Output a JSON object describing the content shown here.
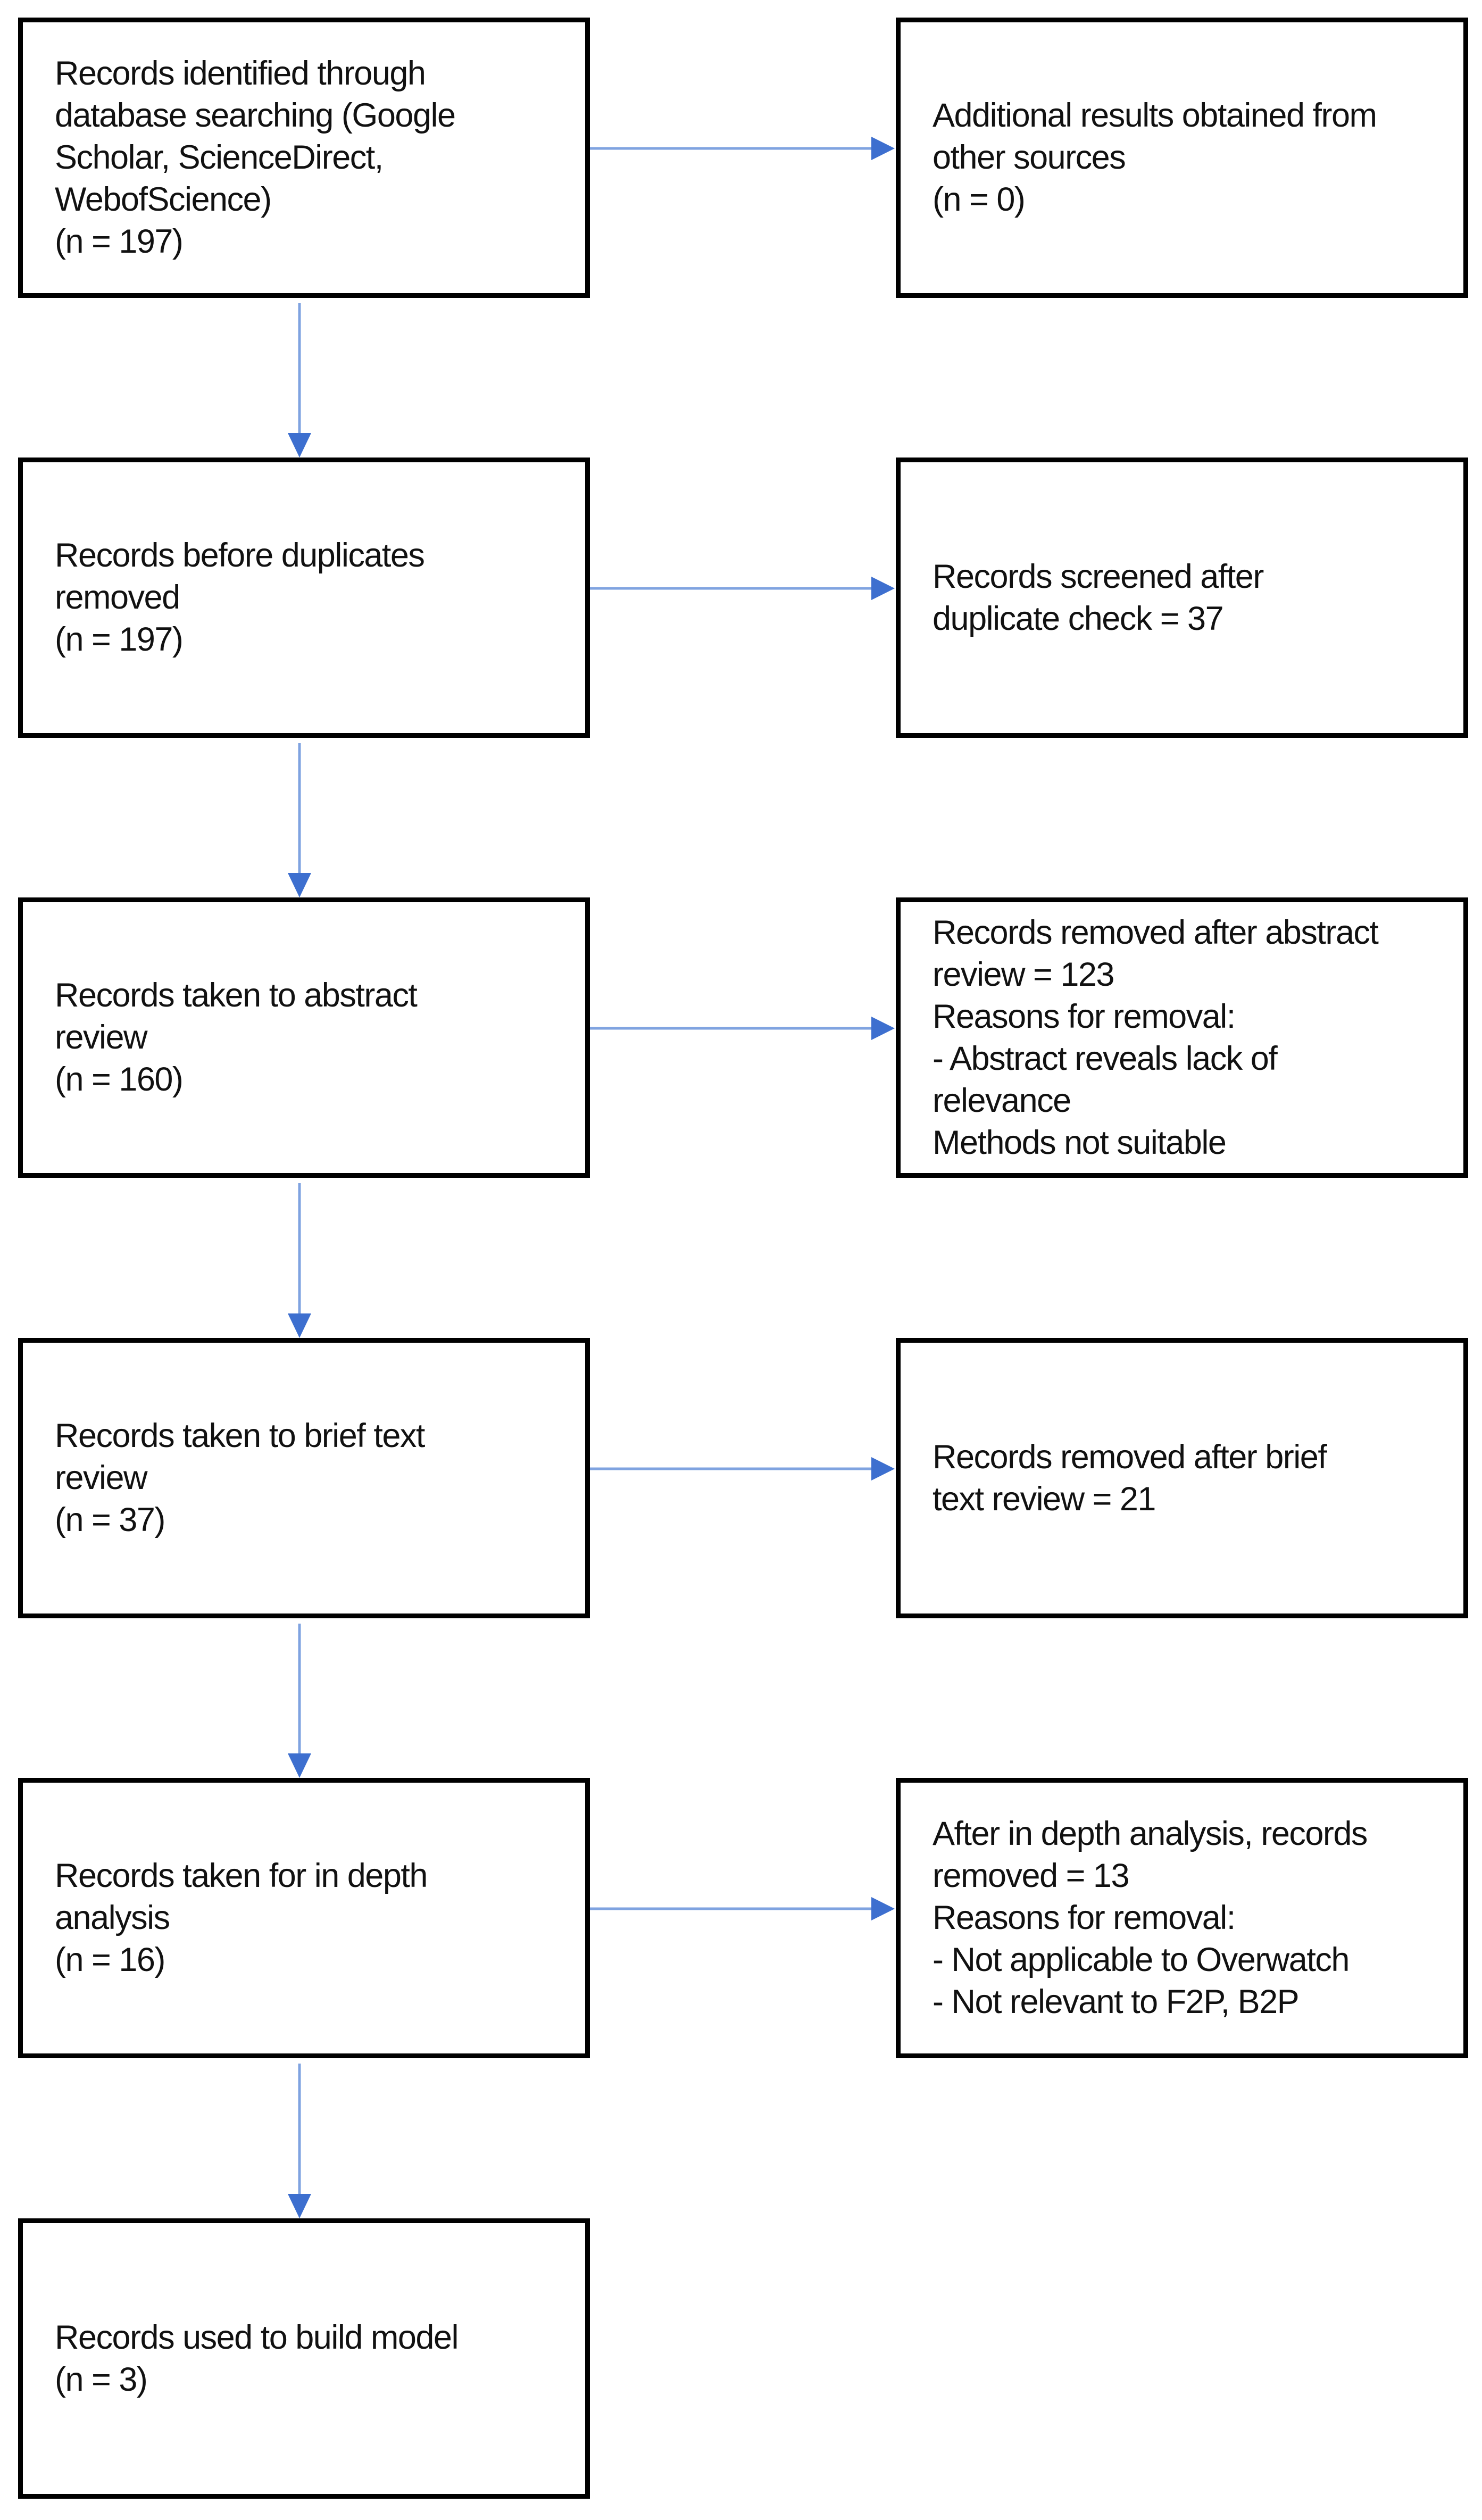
{
  "diagram": {
    "type": "flowchart",
    "colors": {
      "box_border": "#000000",
      "arrow_line": "#7fa3e0",
      "arrow_head": "#3d6fcf"
    },
    "left_column": [
      {
        "lines": [
          "Records identified through",
          "database searching (Google",
          "Scholar, ScienceDirect,",
          "WebofScience)",
          "(n = 197)"
        ]
      },
      {
        "lines": [
          "Records before duplicates",
          "removed",
          "(n = 197)"
        ]
      },
      {
        "lines": [
          "Records taken to abstract",
          "review",
          "(n = 160)"
        ]
      },
      {
        "lines": [
          "Records taken to brief text",
          "review",
          "(n = 37)"
        ]
      },
      {
        "lines": [
          "Records taken for in depth",
          "analysis",
          "(n = 16)"
        ]
      },
      {
        "lines": [
          "Records used to build model",
          "(n = 3)"
        ]
      }
    ],
    "right_column": [
      {
        "lines": [
          "Additional results obtained from",
          "other sources",
          "(n = 0)"
        ]
      },
      {
        "lines": [
          "Records screened after",
          "duplicate check = 37"
        ]
      },
      {
        "lines": [
          "Records removed after abstract",
          "review = 123",
          "Reasons for removal:",
          "- Abstract reveals lack of",
          "relevance",
          "Methods not suitable"
        ]
      },
      {
        "lines": [
          "Records removed after brief",
          "text review = 21"
        ]
      },
      {
        "lines": [
          "After in depth analysis, records",
          "removed = 13",
          "Reasons for removal:",
          "- Not applicable to Overwatch",
          "- Not relevant to F2P, B2P"
        ]
      }
    ]
  }
}
